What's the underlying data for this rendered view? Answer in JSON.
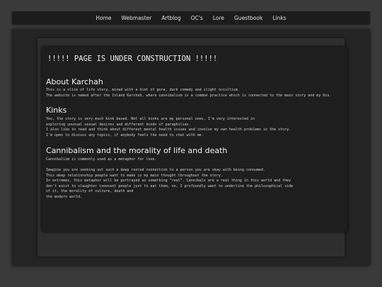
{
  "nav": {
    "items": [
      "Home",
      "Webmaster",
      "Artblog",
      "OC's",
      "Lore",
      "Guestbook",
      "Links"
    ]
  },
  "banner": "!!!!! PAGE IS UNDER CONSTRUCTION !!!!!",
  "about": {
    "title": "About Karchah",
    "lines": [
      "This is a slice of life story, mixed with a hint of gore, dark comedy and slight occultism.",
      "The website is named after the Island Karchah, where cannibalism is a common practice which is connected to the main story and my Ocs."
    ]
  },
  "kinks": {
    "title": "Kinks",
    "lines": [
      "Yes, the story is very much kink based. Not all kinks are my personal ones, I'm very interested in",
      "exploring unusual sexual desires and different kinds of paraphilias.",
      "I also like to read and think about different mental health issues and involve my own health problems in the story.",
      "I'm open to discuss any topics, if anybody feels the need to chat with me."
    ]
  },
  "cannibalism": {
    "title": "Cannibalism and the morality of life and death",
    "intro": "Cannibalism is commonly used as a metaphor for love.",
    "lines": [
      "Imagine you are seeking out such a deep rooted connection to a person you are okay with being consumed.",
      "This deep relationship people want to make is my main thought throughout the story.",
      "In extremes, this metaphor will be portrayed as something \"real\". Cannibals are a real thing in this world and they",
      "don't exist to slaughter innocent people just to eat them, no, I profoundly want to underline the philosophical side",
      "of it, the morality of culture, death and",
      "the modern world."
    ]
  }
}
